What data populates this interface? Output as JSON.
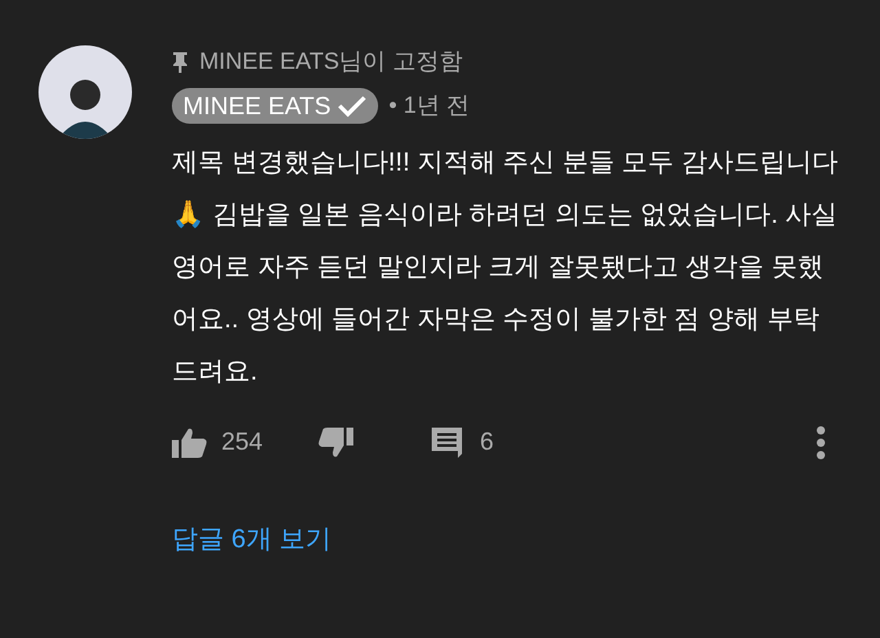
{
  "comment": {
    "pinned_by": "MINEE EATS님이 고정함",
    "author": "MINEE EATS",
    "verified": true,
    "time": "• 1년 전",
    "text": "제목 변경했습니다!!! 지적해 주신 분들 모두 감사드립니다🙏 김밥을 일본 음식이라 하려던 의도는 없었습니다. 사실 영어로 자주 듣던 말인지라 크게 잘못됐다고 생각을 못했어요.. 영상에 들어간 자막은 수정이 불가한 점 양해 부탁드려요.",
    "likes": "254",
    "replies_count": "6",
    "view_replies": "답글 6개 보기"
  }
}
